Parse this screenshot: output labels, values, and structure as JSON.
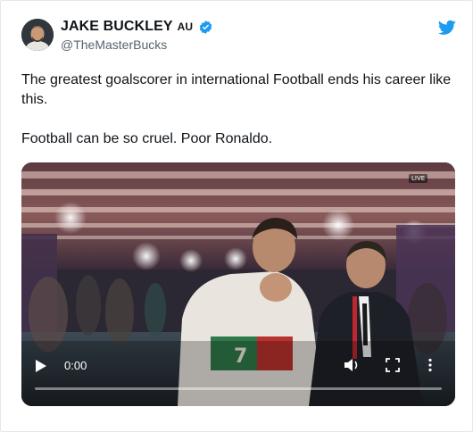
{
  "tweet": {
    "author": {
      "name": "JAKE BUCKLEY",
      "flag": "AU",
      "handle": "@TheMasterBucks",
      "verified": true
    },
    "paragraphs": [
      "The greatest goalscorer in international Football ends his career like this.",
      "Football can be so cruel. Poor Ronaldo."
    ],
    "video": {
      "time": "0:00",
      "progress": 0,
      "badge": "LIVE"
    }
  },
  "icons": {
    "brand": "twitter-bird-icon",
    "verified": "verified-badge-icon",
    "play": "play-icon",
    "volume": "volume-icon",
    "fullscreen": "fullscreen-icon",
    "more": "more-icon"
  },
  "colors": {
    "twitter_blue": "#1d9bf0",
    "text": "#0f1419",
    "secondary": "#536471",
    "border": "#e1e8ed"
  }
}
